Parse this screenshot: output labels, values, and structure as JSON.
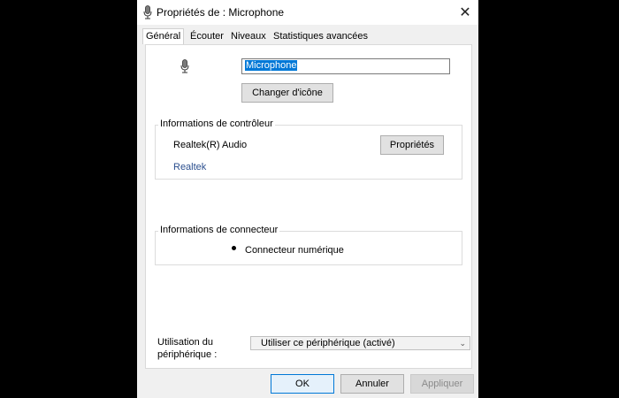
{
  "window": {
    "title": "Propriétés de : Microphone",
    "close_glyph": "✕"
  },
  "tabs": [
    {
      "label": "Général",
      "active": true
    },
    {
      "label": "Écouter"
    },
    {
      "label": "Niveaux"
    },
    {
      "label": "Statistiques avancées"
    }
  ],
  "general": {
    "device_name": "Microphone",
    "change_icon_label": "Changer d'icône",
    "controller": {
      "group_label": "Informations de contrôleur",
      "name": "Realtek(R) Audio",
      "vendor": "Realtek",
      "properties_label": "Propriétés"
    },
    "connector": {
      "group_label": "Informations de connecteur",
      "label": "Connecteur numérique"
    },
    "usage": {
      "label": "Utilisation du\npériphérique :",
      "selected": "Utiliser ce périphérique (activé)"
    }
  },
  "buttons": {
    "ok": "OK",
    "cancel": "Annuler",
    "apply": "Appliquer"
  },
  "colors": {
    "accent": "#0078d7",
    "vendor_text": "#2b4f8e",
    "background": "#f0f0f0"
  },
  "icons": {
    "title": "microphone-icon",
    "device": "microphone-icon",
    "close": "close-icon",
    "dropdown": "chevron-down-icon"
  }
}
